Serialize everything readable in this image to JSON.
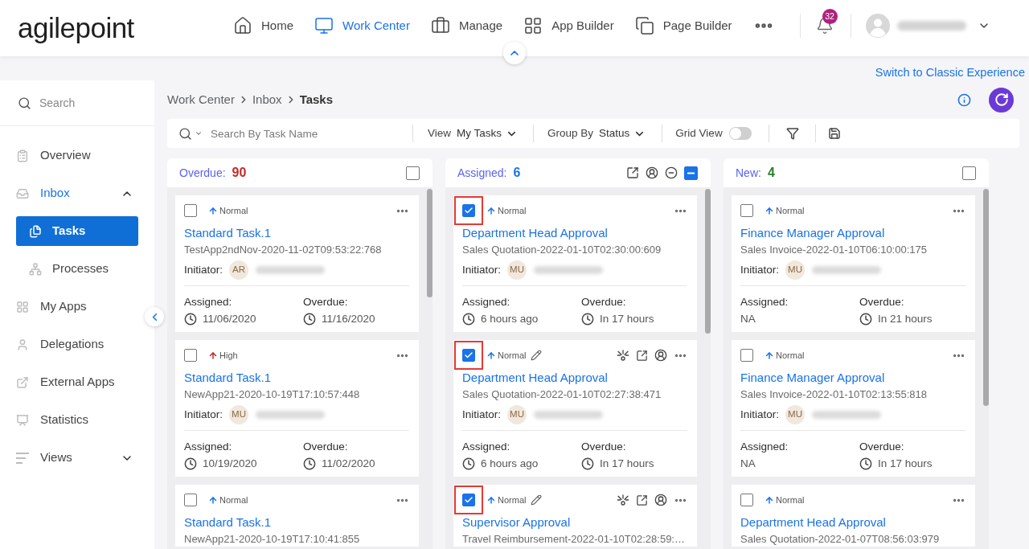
{
  "header": {
    "logo": "agilepoint",
    "nav": [
      {
        "label": "Home",
        "selected": false
      },
      {
        "label": "Work Center",
        "selected": true
      },
      {
        "label": "Manage",
        "selected": false
      },
      {
        "label": "App Builder",
        "selected": false
      },
      {
        "label": "Page Builder",
        "selected": false
      }
    ],
    "notifications": {
      "count": "32"
    }
  },
  "classic_link": "Switch to Classic Experience",
  "sidebar": {
    "search_placeholder": "Search",
    "items": [
      {
        "label": "Overview",
        "selected": false
      },
      {
        "label": "Inbox",
        "selected": false,
        "expanded": true,
        "children": [
          {
            "label": "Tasks",
            "selected": true
          },
          {
            "label": "Processes",
            "selected": false
          }
        ]
      },
      {
        "label": "My Apps",
        "selected": false
      },
      {
        "label": "Delegations",
        "selected": false
      },
      {
        "label": "External Apps",
        "selected": false
      },
      {
        "label": "Statistics",
        "selected": false
      },
      {
        "label": "Views",
        "selected": false,
        "expanded": false
      }
    ]
  },
  "breadcrumb": [
    "Work Center",
    "Inbox",
    "Tasks"
  ],
  "toolbar": {
    "search_placeholder": "Search By Task Name",
    "view": {
      "label": "View",
      "value": "My Tasks"
    },
    "group_by": {
      "label": "Group By",
      "value": "Status"
    },
    "grid_view": {
      "label": "Grid View",
      "on": false
    }
  },
  "columns": [
    {
      "title": "Overdue:",
      "count": "90",
      "color": "#c62828",
      "checked": false,
      "indeterminate": false,
      "show_actions": false,
      "cards": [
        {
          "checked": false,
          "highlighted": false,
          "priority": {
            "label": "Normal",
            "color": "#1a73e8"
          },
          "editable": false,
          "show_actions": false,
          "title": "Standard Task.1",
          "subtitle": "TestApp2ndNov-2020-11-02T09:53:22:768",
          "initiator_label": "Initiator:",
          "initials": "AR",
          "assigned_label": "Assigned:",
          "assigned": "11/06/2020",
          "assigned_timed": true,
          "overdue_label": "Overdue:",
          "overdue": "11/16/2020",
          "overdue_timed": true
        },
        {
          "checked": false,
          "highlighted": false,
          "priority": {
            "label": "High",
            "color": "#c62828"
          },
          "editable": false,
          "show_actions": false,
          "title": "Standard Task.1",
          "subtitle": "NewApp21-2020-10-19T17:10:57:448",
          "initiator_label": "Initiator:",
          "initials": "MU",
          "assigned_label": "Assigned:",
          "assigned": "10/19/2020",
          "assigned_timed": true,
          "overdue_label": "Overdue:",
          "overdue": "11/02/2020",
          "overdue_timed": true
        },
        {
          "checked": false,
          "highlighted": false,
          "priority": {
            "label": "Normal",
            "color": "#1a73e8"
          },
          "editable": false,
          "show_actions": false,
          "title": "Standard Task.1",
          "subtitle": "NewApp21-2020-10-19T17:10:41:855"
        }
      ]
    },
    {
      "title": "Assigned:",
      "count": "6",
      "color": "#1a73e8",
      "checked": false,
      "indeterminate": true,
      "show_actions": true,
      "cards": [
        {
          "checked": true,
          "highlighted": true,
          "priority": {
            "label": "Normal",
            "color": "#1a73e8"
          },
          "editable": false,
          "show_actions": false,
          "title": "Department Head Approval",
          "subtitle": "Sales Quotation-2022-01-10T02:30:00:609",
          "initiator_label": "Initiator:",
          "initials": "MU",
          "assigned_label": "Assigned:",
          "assigned": "6 hours ago",
          "assigned_timed": true,
          "overdue_label": "Overdue:",
          "overdue": "In 17 hours",
          "overdue_timed": true
        },
        {
          "checked": true,
          "highlighted": true,
          "priority": {
            "label": "Normal",
            "color": "#1a73e8"
          },
          "editable": true,
          "show_actions": true,
          "title": "Department Head Approval",
          "subtitle": "Sales Quotation-2022-01-10T02:27:38:471",
          "initiator_label": "Initiator:",
          "initials": "MU",
          "assigned_label": "Assigned:",
          "assigned": "6 hours ago",
          "assigned_timed": true,
          "overdue_label": "Overdue:",
          "overdue": "In 17 hours",
          "overdue_timed": true
        },
        {
          "checked": true,
          "highlighted": true,
          "priority": {
            "label": "Normal",
            "color": "#1a73e8"
          },
          "editable": true,
          "show_actions": true,
          "title": "Supervisor Approval",
          "subtitle": "Travel Reimbursement-2022-01-10T02:28:59:…"
        }
      ]
    },
    {
      "title": "New:",
      "count": "4",
      "color": "#2e7d32",
      "checked": false,
      "indeterminate": false,
      "show_actions": false,
      "cards": [
        {
          "checked": false,
          "highlighted": false,
          "priority": {
            "label": "Normal",
            "color": "#1a73e8"
          },
          "editable": false,
          "show_actions": false,
          "title": "Finance Manager Approval",
          "subtitle": "Sales Invoice-2022-01-10T06:10:00:175",
          "initiator_label": "Initiator:",
          "initials": "MU",
          "assigned_label": "Assigned:",
          "assigned": "NA",
          "assigned_timed": false,
          "overdue_label": "Overdue:",
          "overdue": "In 21 hours",
          "overdue_timed": true
        },
        {
          "checked": false,
          "highlighted": false,
          "priority": {
            "label": "Normal",
            "color": "#1a73e8"
          },
          "editable": false,
          "show_actions": false,
          "title": "Finance Manager Approval",
          "subtitle": "Sales Invoice-2022-01-10T02:13:55:818",
          "initiator_label": "Initiator:",
          "initials": "MU",
          "assigned_label": "Assigned:",
          "assigned": "NA",
          "assigned_timed": false,
          "overdue_label": "Overdue:",
          "overdue": "In 17 hours",
          "overdue_timed": true
        },
        {
          "checked": false,
          "highlighted": false,
          "priority": {
            "label": "Normal",
            "color": "#1a73e8"
          },
          "editable": false,
          "show_actions": false,
          "title": "Department Head Approval",
          "subtitle": "Sales Quotation-2022-01-07T08:56:03:979"
        }
      ]
    }
  ]
}
